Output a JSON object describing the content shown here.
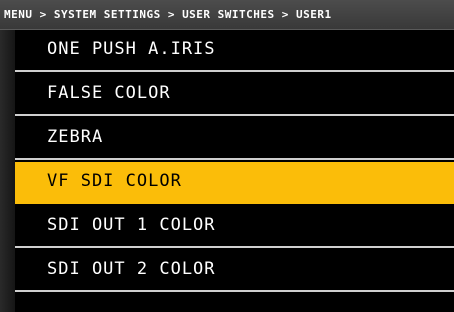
{
  "header": {
    "breadcrumb": "MENU > SYSTEM SETTINGS > USER SWITCHES > USER1"
  },
  "menu": {
    "items": [
      {
        "label": "ONE PUSH A.IRIS",
        "selected": false
      },
      {
        "label": "FALSE COLOR",
        "selected": false
      },
      {
        "label": "ZEBRA",
        "selected": false
      },
      {
        "label": "VF SDI COLOR",
        "selected": true
      },
      {
        "label": "SDI OUT 1 COLOR",
        "selected": false
      },
      {
        "label": "SDI OUT 2 COLOR",
        "selected": false
      }
    ]
  },
  "colors": {
    "background": "#000000",
    "highlight": "#fbbd09",
    "divider": "#cfcfcf",
    "header_bg": "#444444",
    "text": "#ffffff"
  }
}
